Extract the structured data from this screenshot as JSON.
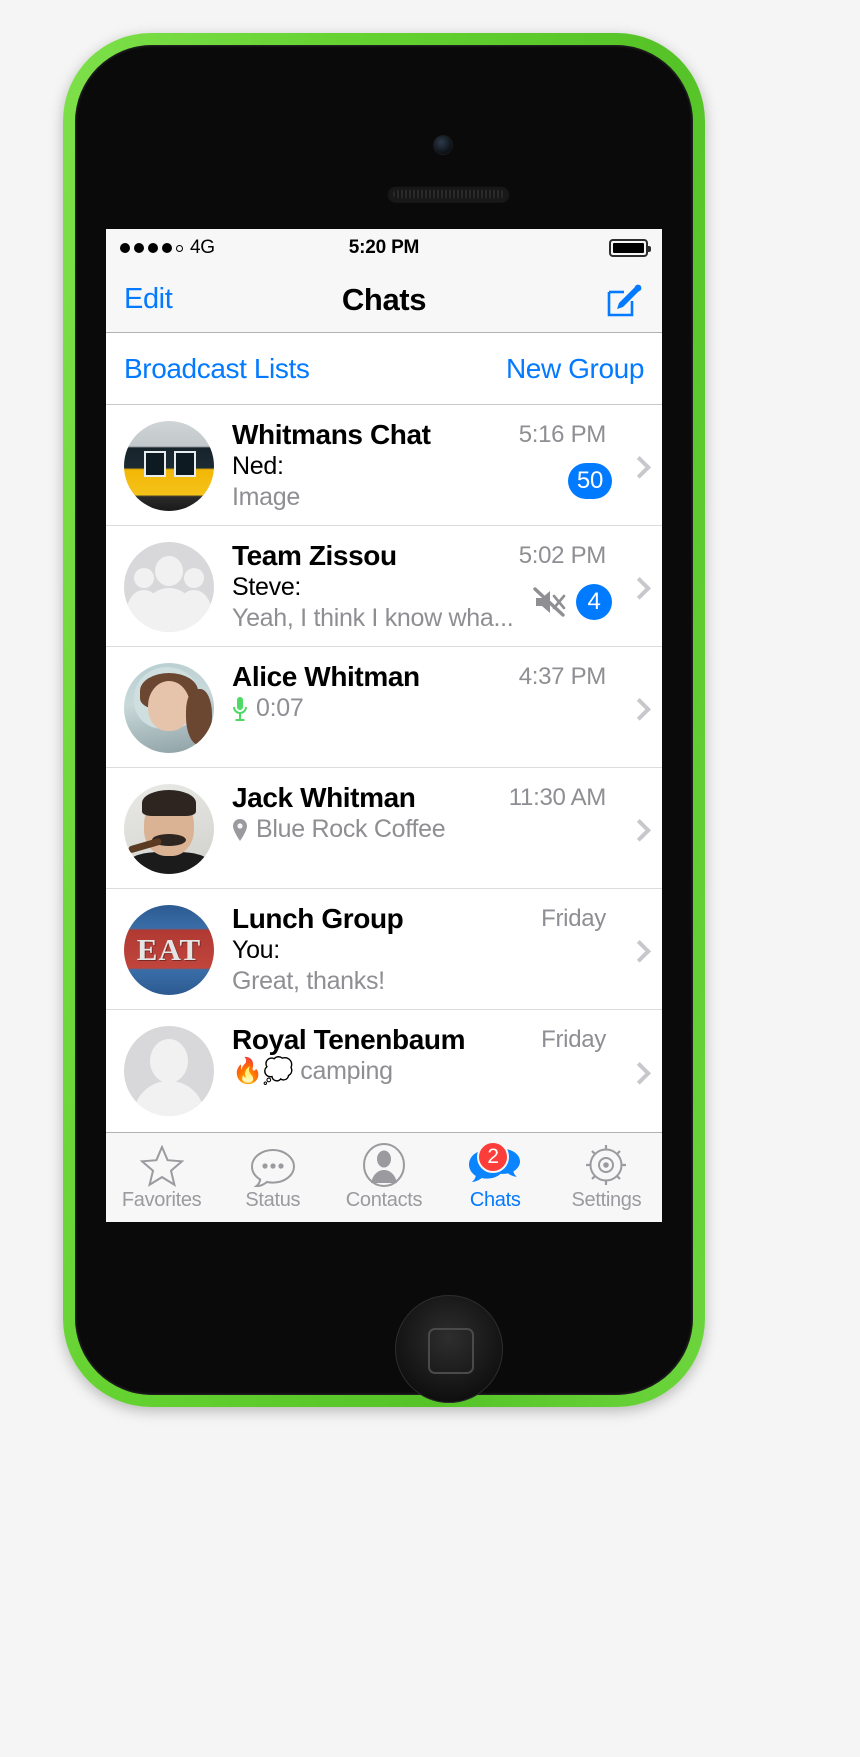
{
  "status_bar": {
    "signal_dots_filled": 4,
    "signal_dots_total": 5,
    "carrier": "4G",
    "time": "5:20 PM",
    "battery_icon": "battery-full-icon"
  },
  "nav_bar": {
    "left_button": "Edit",
    "title": "Chats",
    "right_icon": "compose-icon"
  },
  "sub_bar": {
    "broadcast_lists": "Broadcast Lists",
    "new_group": "New Group"
  },
  "chats": [
    {
      "name": "Whitmans Chat",
      "time": "5:16 PM",
      "sender": "Ned:",
      "preview": "Image",
      "avatar": "tram-photo-avatar",
      "badge": "50",
      "muted": false,
      "preview_icon": null
    },
    {
      "name": "Team Zissou",
      "time": "5:02 PM",
      "sender": "Steve:",
      "preview": "Yeah, I think I know wha...",
      "avatar": "group-placeholder-avatar",
      "badge": "4",
      "muted": true,
      "preview_icon": null
    },
    {
      "name": "Alice Whitman",
      "time": "4:37 PM",
      "sender": null,
      "preview": "0:07",
      "avatar": "woman-photo-avatar",
      "badge": null,
      "muted": false,
      "preview_icon": "microphone-icon"
    },
    {
      "name": "Jack Whitman",
      "time": "11:30 AM",
      "sender": null,
      "preview": "Blue Rock Coffee",
      "avatar": "man-with-pipe-photo-avatar",
      "badge": null,
      "muted": false,
      "preview_icon": "location-pin-icon"
    },
    {
      "name": "Lunch Group",
      "time": "Friday",
      "sender": "You:",
      "preview": "Great, thanks!",
      "avatar": "eat-sign-photo-avatar",
      "badge": null,
      "muted": false,
      "preview_icon": null
    },
    {
      "name": "Royal Tenenbaum",
      "time": "Friday",
      "sender": null,
      "preview": "🔥💭 camping",
      "avatar": "person-placeholder-avatar",
      "badge": null,
      "muted": false,
      "preview_icon": null
    }
  ],
  "tab_bar": {
    "tabs": [
      {
        "label": "Favorites",
        "icon": "star-icon",
        "active": false,
        "badge": null
      },
      {
        "label": "Status",
        "icon": "speech-bubble-icon",
        "active": false,
        "badge": null
      },
      {
        "label": "Contacts",
        "icon": "person-circle-icon",
        "active": false,
        "badge": null
      },
      {
        "label": "Chats",
        "icon": "chat-bubbles-icon",
        "active": true,
        "badge": "2"
      },
      {
        "label": "Settings",
        "icon": "gear-icon",
        "active": false,
        "badge": null
      }
    ]
  },
  "colors": {
    "accent_blue": "#037aff",
    "badge_blue": "#007aff",
    "badge_red": "#fc3d39",
    "secondary_text": "#8e8e93",
    "phone_body_green": "#63d12f"
  }
}
